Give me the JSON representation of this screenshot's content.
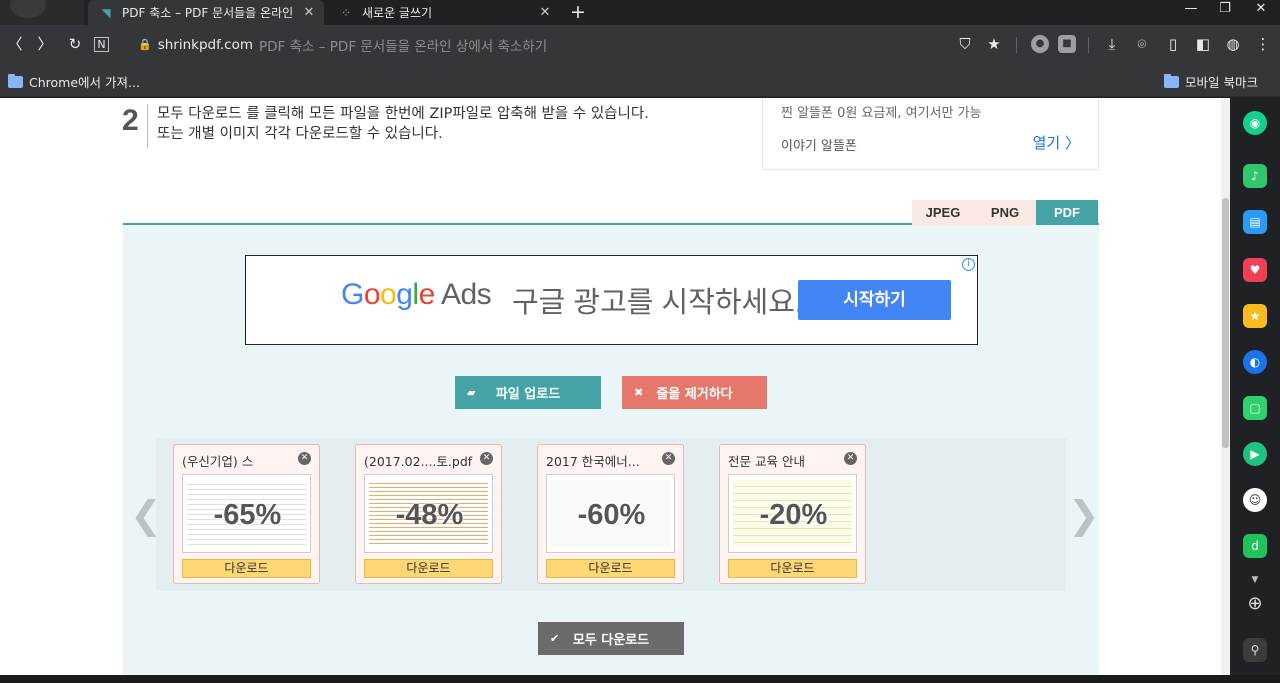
{
  "tabs": [
    {
      "title": "PDF 축소 – PDF 문서들을 온라인",
      "active": true
    },
    {
      "title": "새로운 글쓰기",
      "active": false
    }
  ],
  "window": {
    "minimize": "—",
    "restore": "❐",
    "close": "✕"
  },
  "toolbar": {
    "host": "shrinkpdf.com",
    "page_title": "PDF 축소 – PDF 문서들을 온라인 상에서 축소하기"
  },
  "bookmarks": {
    "left": "Chrome에서 가져...",
    "right": "모바일 북마크"
  },
  "step": {
    "number": "2",
    "text_line1": "모두 다운로드 를 클릭해 모든 파일을 한번에 ZIP파일로 압축해 받을 수 있습니다.",
    "text_line2": "또는 개별 이미지 각각 다운로드할 수 있습니다."
  },
  "side_ad": {
    "line1": "찐 알뜰폰 0원 요금제, 여기서만 가능",
    "line2": "이야기 알뜰폰",
    "open": "열기"
  },
  "formats": [
    "JPEG",
    "PNG",
    "PDF"
  ],
  "selected_format": "PDF",
  "banner": {
    "google": "Google",
    "ads": "Ads",
    "tagline": "구글 광고를 시작하세요.",
    "cta": "시작하기",
    "info": "i"
  },
  "actions": {
    "upload": "파일 업로드",
    "clear": "줄을 제거하다",
    "download_all": "모두 다운로드"
  },
  "files": [
    {
      "name": "(우신기업) 스",
      "reduction": "-65%",
      "download": "다운로드"
    },
    {
      "name": "(2017.02....토.pdf",
      "reduction": "-48%",
      "download": "다운로드"
    },
    {
      "name": "2017 한국에너...",
      "reduction": "-60%",
      "download": "다운로드"
    },
    {
      "name": "전문 교육 안내",
      "reduction": "-20%",
      "download": "다운로드"
    }
  ],
  "colors": {
    "accent": "#45a3a5",
    "clear": "#e5786a",
    "download": "#fdd774"
  }
}
